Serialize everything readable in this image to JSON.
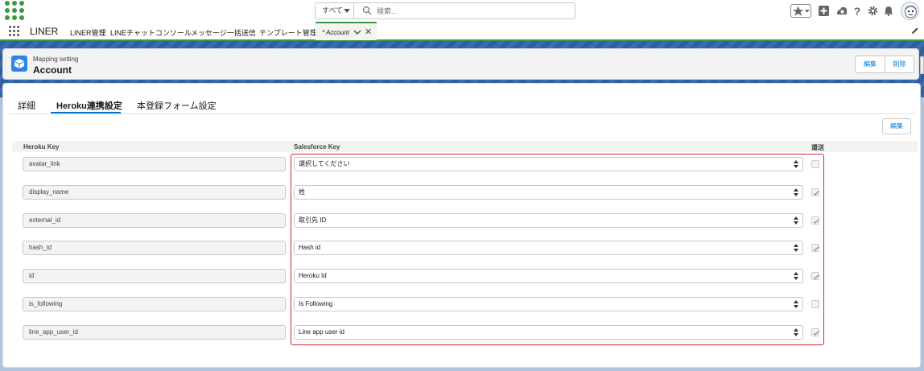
{
  "search": {
    "scope": "すべて",
    "placeholder": "検索..."
  },
  "nav": {
    "app_name": "LINER",
    "items": [
      "LINER管理",
      "LINEチャットコンソール",
      "メッセージ一括送信",
      "テンプレート管理"
    ],
    "active_tab": "* Account"
  },
  "header": {
    "subtitle": "Mapping setting",
    "title": "Account",
    "edit": "編集",
    "delete": "削除"
  },
  "tabs": [
    {
      "label": "詳細",
      "active": false
    },
    {
      "label": "Heroku連携設定",
      "active": true
    },
    {
      "label": "本登録フォーム設定",
      "active": false
    }
  ],
  "section": {
    "edit": "編集"
  },
  "columns": {
    "heroku_key": "Heroku Key",
    "salesforce_key": "Salesforce Key",
    "writeback": "還送"
  },
  "rows": [
    {
      "heroku_key": "avatar_link",
      "salesforce_key": "選択してください",
      "checked": false
    },
    {
      "heroku_key": "display_name",
      "salesforce_key": "姓",
      "checked": true
    },
    {
      "heroku_key": "external_id",
      "salesforce_key": "取引先 ID",
      "checked": true
    },
    {
      "heroku_key": "hash_id",
      "salesforce_key": "Hash id",
      "checked": true
    },
    {
      "heroku_key": "id",
      "salesforce_key": "Heroku Id",
      "checked": true
    },
    {
      "heroku_key": "is_following",
      "salesforce_key": "Is Following",
      "checked": false
    },
    {
      "heroku_key": "line_app_user_id",
      "salesforce_key": "Line app user id",
      "checked": true
    }
  ],
  "colors": {
    "accent": "#0176d3",
    "brand_green": "#3a9b3f",
    "highlight_frame": "#d6263a"
  },
  "icons": [
    "app-launcher-logo",
    "search-icon",
    "star-icon",
    "add-icon",
    "trailhead-icon",
    "help-icon",
    "gear-icon",
    "bell-icon",
    "avatar",
    "waffle-icon",
    "chevron-down-icon",
    "close-icon",
    "pencil-icon",
    "cube-icon"
  ]
}
